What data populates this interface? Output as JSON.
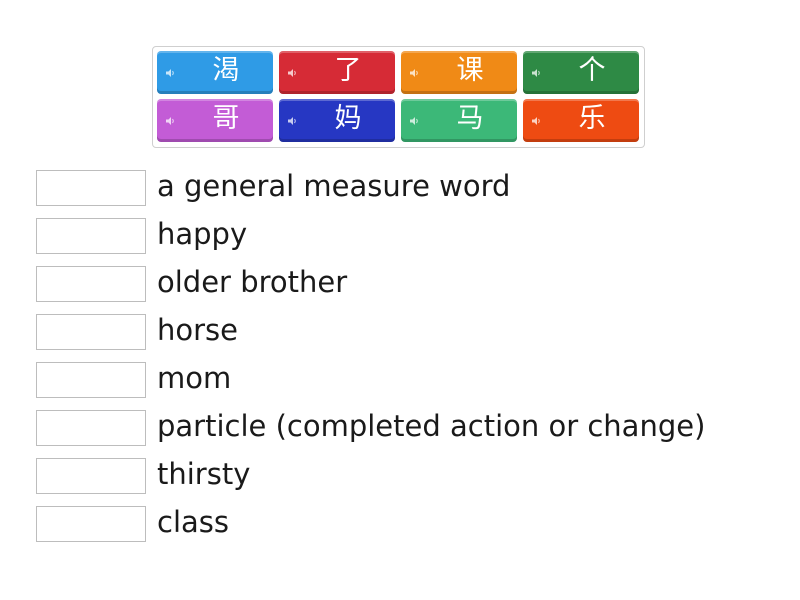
{
  "tiles": [
    {
      "word": "渴",
      "color": "#2f9be6",
      "icon": "speaker-icon"
    },
    {
      "word": "了",
      "color": "#d62b36",
      "icon": "speaker-icon"
    },
    {
      "word": "课",
      "color": "#f08a16",
      "icon": "speaker-icon"
    },
    {
      "word": "个",
      "color": "#2e8a45",
      "icon": "speaker-icon"
    },
    {
      "word": "哥",
      "color": "#c35cd6",
      "icon": "speaker-icon"
    },
    {
      "word": "妈",
      "color": "#2637c3",
      "icon": "speaker-icon"
    },
    {
      "word": "马",
      "color": "#3cb878",
      "icon": "speaker-icon"
    },
    {
      "word": "乐",
      "color": "#ee4b12",
      "icon": "speaker-icon"
    }
  ],
  "definitions": [
    {
      "text": "a general measure word"
    },
    {
      "text": "happy"
    },
    {
      "text": "older brother"
    },
    {
      "text": "horse"
    },
    {
      "text": "mom"
    },
    {
      "text": "particle (completed action or change)"
    },
    {
      "text": "thirsty"
    },
    {
      "text": "class"
    }
  ]
}
